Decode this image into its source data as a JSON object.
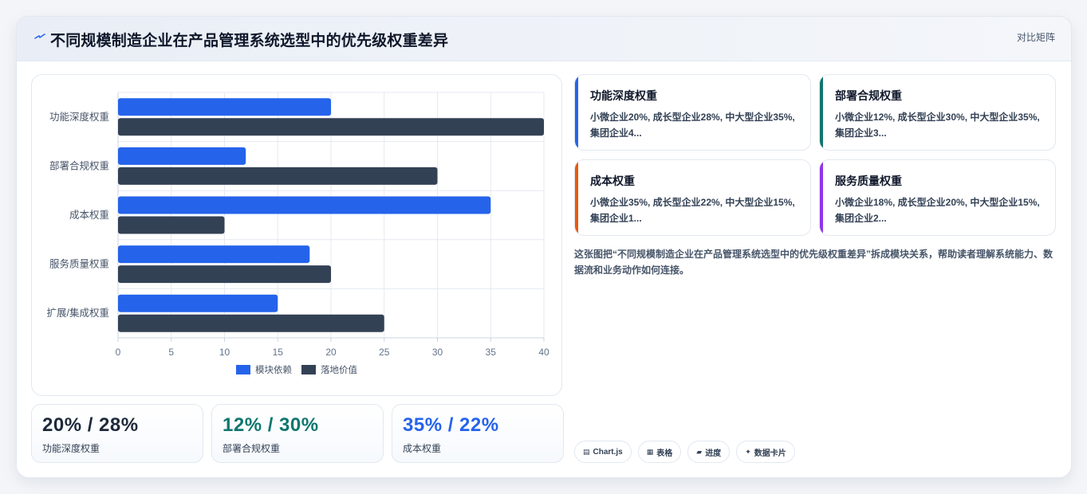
{
  "header": {
    "title": "不同规模制造企业在产品管理系统选型中的优先级权重差异",
    "tag": "对比矩阵"
  },
  "chart_data": {
    "type": "bar",
    "orientation": "horizontal",
    "categories": [
      "功能深度权重",
      "部署合规权重",
      "成本权重",
      "服务质量权重",
      "扩展/集成权重"
    ],
    "series": [
      {
        "name": "模块依赖",
        "color": "#2563eb",
        "values": [
          20,
          12,
          35,
          18,
          15
        ]
      },
      {
        "name": "落地价值",
        "color": "#334155",
        "values": [
          40,
          30,
          10,
          20,
          25
        ]
      }
    ],
    "xlim": [
      0,
      40
    ],
    "xticks": [
      0,
      5,
      10,
      15,
      20,
      25,
      30,
      35,
      40
    ],
    "grid": true,
    "legend": "bottom"
  },
  "kpis": [
    {
      "value": "20% / 28%",
      "label": "功能深度权重",
      "color": "#1e293b"
    },
    {
      "value": "12% / 30%",
      "label": "部署合规权重",
      "color": "#0f766e"
    },
    {
      "value": "35% / 22%",
      "label": "成本权重",
      "color": "#2563eb"
    }
  ],
  "cards": [
    {
      "title": "功能深度权重",
      "desc": "小微企业20%, 成长型企业28%, 中大型企业35%, 集团企业4...",
      "accent": "#2563eb"
    },
    {
      "title": "部署合规权重",
      "desc": "小微企业12%, 成长型企业30%, 中大型企业35%, 集团企业3...",
      "accent": "#0f766e"
    },
    {
      "title": "成本权重",
      "desc": "小微企业35%, 成长型企业22%, 中大型企业15%, 集团企业1...",
      "accent": "#ea580c"
    },
    {
      "title": "服务质量权重",
      "desc": "小微企业18%, 成长型企业20%, 中大型企业15%, 集团企业2...",
      "accent": "#9333ea"
    }
  ],
  "summary": "这张图把“不同规模制造企业在产品管理系统选型中的优先级权重差异”拆成模块关系，帮助读者理解系统能力、数据流和业务动作如何连接。",
  "chips": [
    {
      "icon": "chart-icon",
      "glyph": "▤",
      "label": "Chart.js"
    },
    {
      "icon": "table-icon",
      "glyph": "▦",
      "label": "表格"
    },
    {
      "icon": "progress-icon",
      "glyph": "▰",
      "label": "进度"
    },
    {
      "icon": "data-card-icon",
      "glyph": "✦",
      "label": "数据卡片"
    }
  ]
}
